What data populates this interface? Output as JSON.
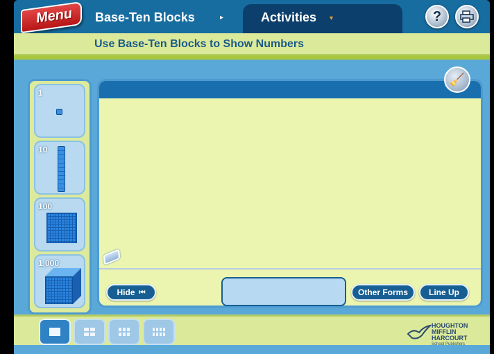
{
  "header": {
    "menu_label": "Menu",
    "title": "Base-Ten Blocks",
    "breadcrumb_arrow": "▸",
    "activities_label": "Activities",
    "activities_arrow": "▾",
    "help_label": "?",
    "print_icon": "printer-icon"
  },
  "subtitle": "Use Base-Ten Blocks to Show Numbers",
  "palette": {
    "items": [
      {
        "label": "1",
        "icon": "unit-cube-icon"
      },
      {
        "label": "10",
        "icon": "rod-icon"
      },
      {
        "label": "100",
        "icon": "flat-icon"
      },
      {
        "label": "1,000",
        "icon": "cube-icon"
      }
    ]
  },
  "workspace": {
    "clear_icon": "broom-icon",
    "eraser_icon": "eraser-icon",
    "hide_label": "Hide",
    "hide_icon": "⏮",
    "other_forms_label": "Other Forms",
    "line_up_label": "Line Up",
    "readout_value": ""
  },
  "view_tabs": [
    {
      "name": "one-pane",
      "active": true
    },
    {
      "name": "two-panes",
      "active": false
    },
    {
      "name": "three-panes",
      "active": false
    },
    {
      "name": "four-panes",
      "active": false
    }
  ],
  "logo": {
    "lines": [
      "HOUGHTON",
      "MIFFLIN",
      "HARCOURT"
    ],
    "sub": "School Publishers"
  },
  "colors": {
    "topbar": "#176da0",
    "workspace_bg": "#ecf5b0",
    "panel_blue": "#5aa8d8",
    "menu_red": "#cc2222"
  }
}
